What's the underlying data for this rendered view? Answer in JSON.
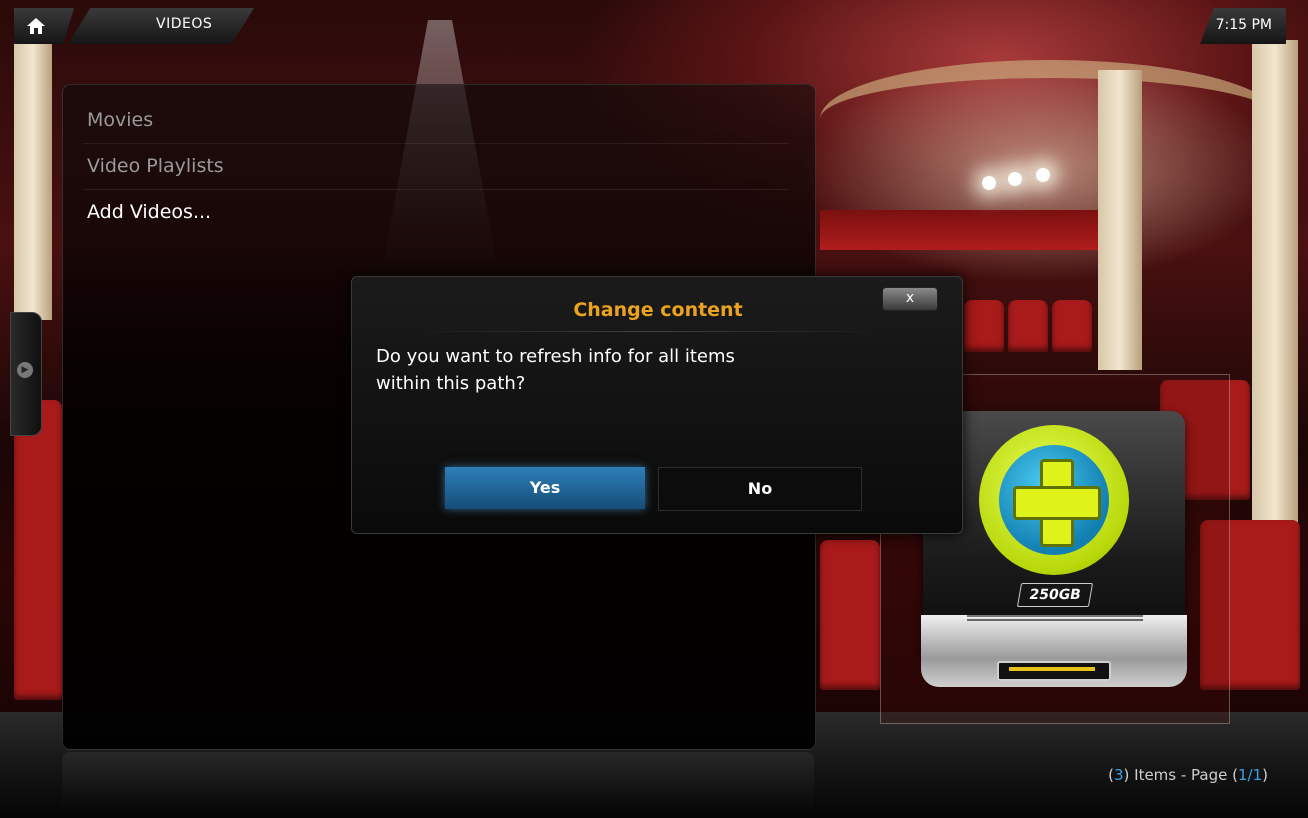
{
  "header": {
    "section_title": "VIDEOS",
    "clock": "7:15 PM"
  },
  "list": {
    "items": [
      {
        "label": "Movies"
      },
      {
        "label": "Video Playlists"
      },
      {
        "label": "Add Videos..."
      }
    ],
    "selected_index": 2
  },
  "thumbnail": {
    "drive_label": "250GB",
    "icon": "add-drive-icon"
  },
  "footer": {
    "items_open": "(",
    "items_count": "3",
    "items_close": ") Items - Page (",
    "page": "1/1",
    "page_close": ")"
  },
  "dialog": {
    "title": "Change content",
    "message": "Do you want to refresh info for all items within this path?",
    "close_label": "x",
    "yes_label": "Yes",
    "no_label": "No",
    "focused_button": "Yes"
  },
  "colors": {
    "accent": "#3d9fe6",
    "dialog_title": "#eba21c",
    "focused_button": "#2d7fb8"
  }
}
